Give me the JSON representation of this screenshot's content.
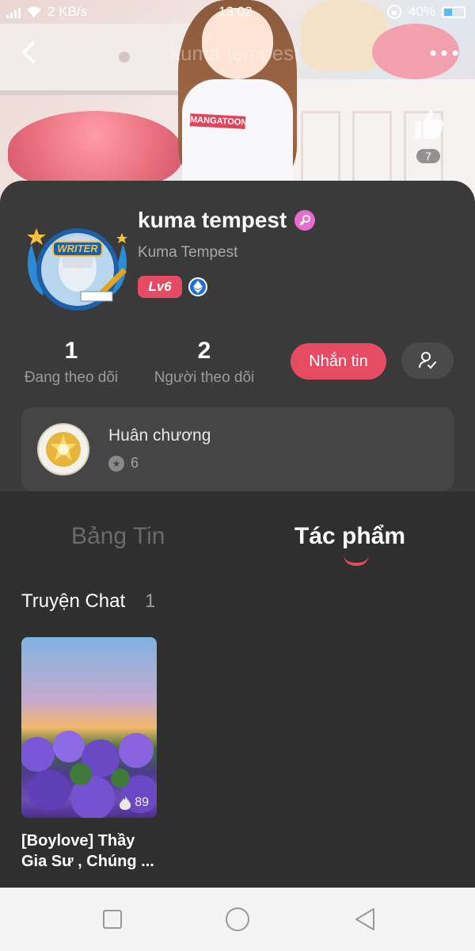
{
  "status_bar": {
    "speed": "2 KB/s",
    "time": "13:02",
    "battery": "40%"
  },
  "header": {
    "ghost_title": "kuma tempest",
    "likes": "7",
    "banner_brand": "MANGATOON"
  },
  "profile": {
    "avatar_badge": "WRITER",
    "username": "kuma tempest",
    "display_name": "Kuma Tempest",
    "level": "Lv6",
    "following_count": "1",
    "following_label": "Đang theo dõi",
    "followers_count": "2",
    "followers_label": "Người theo dõi",
    "message_button": "Nhắn tin"
  },
  "medals": {
    "title": "Huân chương",
    "count": "6"
  },
  "tabs": [
    {
      "label": "Bảng Tin",
      "active": false
    },
    {
      "label": "Tác phẩm",
      "active": true
    }
  ],
  "works": {
    "section_title": "Truyện Chat",
    "section_count": "1",
    "items": [
      {
        "title_line1": "[Boylove] Thầy",
        "title_line2": "Gia Sư , Chúng ...",
        "views": "89"
      }
    ]
  },
  "colors": {
    "accent": "#e64b63",
    "background": "#2f2f2f",
    "card": "#3a3a3a"
  },
  "icons": [
    "back-icon",
    "more-icon",
    "thumb-up-icon",
    "female-icon",
    "ethereum-icon",
    "follow-user-icon",
    "star-icon",
    "fire-icon",
    "square-icon",
    "circle-icon",
    "triangle-back-icon"
  ]
}
